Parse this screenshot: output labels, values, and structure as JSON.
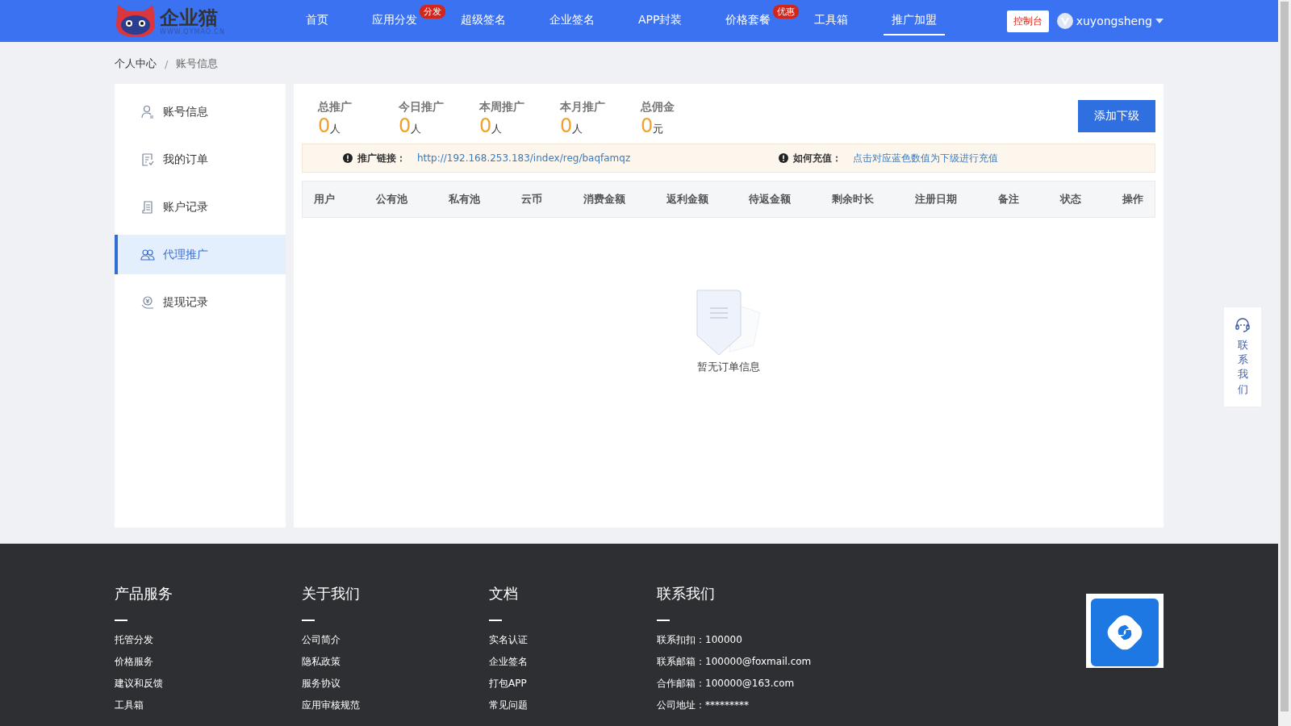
{
  "header": {
    "logo": {
      "name": "企业猫",
      "url": "WWW.QYMAO.CN"
    },
    "nav": [
      {
        "label": "首页",
        "selected": false
      },
      {
        "label": "应用分发",
        "selected": false,
        "badge": "分发"
      },
      {
        "label": "超级签名",
        "selected": false
      },
      {
        "label": "企业签名",
        "selected": false
      },
      {
        "label": "APP封装",
        "selected": false
      },
      {
        "label": "价格套餐",
        "selected": false,
        "badge": "优惠"
      },
      {
        "label": "工具箱",
        "selected": false
      },
      {
        "label": "推广加盟",
        "selected": true
      }
    ],
    "console_button": "控制台",
    "user": "xuyongsheng"
  },
  "breadcrumb": {
    "separator": "/",
    "items": [
      "个人中心",
      "账号信息"
    ]
  },
  "sidebar": {
    "items": [
      {
        "label": "账号信息",
        "kind": "user",
        "selected": false
      },
      {
        "label": "我的订单",
        "kind": "order",
        "selected": false
      },
      {
        "label": "账户记录",
        "kind": "record",
        "selected": false
      },
      {
        "label": "代理推广",
        "kind": "agents",
        "selected": true
      },
      {
        "label": "提现记录",
        "kind": "withdraw",
        "selected": false
      }
    ]
  },
  "stats": [
    {
      "label": "总推广",
      "value": "0",
      "unit": "人"
    },
    {
      "label": "今日推广",
      "value": "0",
      "unit": "人"
    },
    {
      "label": "本周推广",
      "value": "0",
      "unit": "人"
    },
    {
      "label": "本月推广",
      "value": "0",
      "unit": "人"
    },
    {
      "label": "总佣金",
      "value": "0",
      "unit": "元"
    }
  ],
  "add_button": "添加下级",
  "notice": [
    {
      "label": "推广链接：",
      "value": "http://192.168.253.183/index/reg/baqfamqz"
    },
    {
      "label": "如何充值：",
      "value": "点击对应蓝色数值为下级进行充值"
    }
  ],
  "table": {
    "columns": [
      "用户",
      "公有池",
      "私有池",
      "云币",
      "消费金额",
      "返利金额",
      "待返金额",
      "剩余时长",
      "注册日期",
      "备注",
      "状态",
      "操作"
    ],
    "empty_text": "暂无订单信息"
  },
  "float_contact": "联系我们",
  "footer": {
    "columns": [
      {
        "title": "产品服务",
        "links": [
          "托管分发",
          "价格服务",
          "建议和反馈",
          "工具箱"
        ]
      },
      {
        "title": "关于我们",
        "links": [
          "公司简介",
          "隐私政策",
          "服务协议",
          "应用审核规范"
        ]
      },
      {
        "title": "文档",
        "links": [
          "实名认证",
          "企业签名",
          "打包APP",
          "常见问题"
        ]
      },
      {
        "title": "联系我们",
        "links": [
          "联系扣扣：100000",
          "联系邮箱：100000@foxmail.com",
          "合作邮箱：100000@163.com",
          "公司地址：*********"
        ]
      }
    ]
  }
}
